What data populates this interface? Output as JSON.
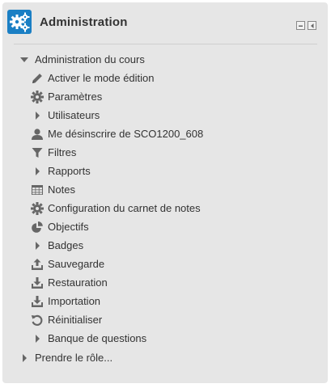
{
  "block": {
    "title": "Administration",
    "icon": "gears-icon",
    "controls": [
      {
        "name": "minimize-icon"
      },
      {
        "name": "dock-icon"
      }
    ]
  },
  "tree": {
    "course_admin": {
      "label": "Administration du cours",
      "expanded": true
    },
    "items": [
      {
        "label": "Activer le mode édition",
        "icon": "pencil-icon"
      },
      {
        "label": "Paramètres",
        "icon": "gear-icon"
      },
      {
        "label": "Utilisateurs",
        "icon": "caret-right-icon"
      },
      {
        "label": "Me désinscrire de SCO1200_608",
        "icon": "user-icon"
      },
      {
        "label": "Filtres",
        "icon": "filter-icon"
      },
      {
        "label": "Rapports",
        "icon": "caret-right-icon"
      },
      {
        "label": "Notes",
        "icon": "table-icon"
      },
      {
        "label": "Configuration du carnet de notes",
        "icon": "gear-icon"
      },
      {
        "label": "Objectifs",
        "icon": "pie-chart-icon"
      },
      {
        "label": "Badges",
        "icon": "caret-right-icon"
      },
      {
        "label": "Sauvegarde",
        "icon": "upload-icon"
      },
      {
        "label": "Restauration",
        "icon": "download-icon"
      },
      {
        "label": "Importation",
        "icon": "download-icon"
      },
      {
        "label": "Réinitialiser",
        "icon": "refresh-icon"
      },
      {
        "label": "Banque de questions",
        "icon": "caret-right-icon"
      }
    ],
    "switch_role": {
      "label": "Prendre le rôle..."
    }
  },
  "colors": {
    "accent": "#1a7fc4",
    "background": "#e6e6e6",
    "text": "#333333",
    "icon": "#666666"
  }
}
